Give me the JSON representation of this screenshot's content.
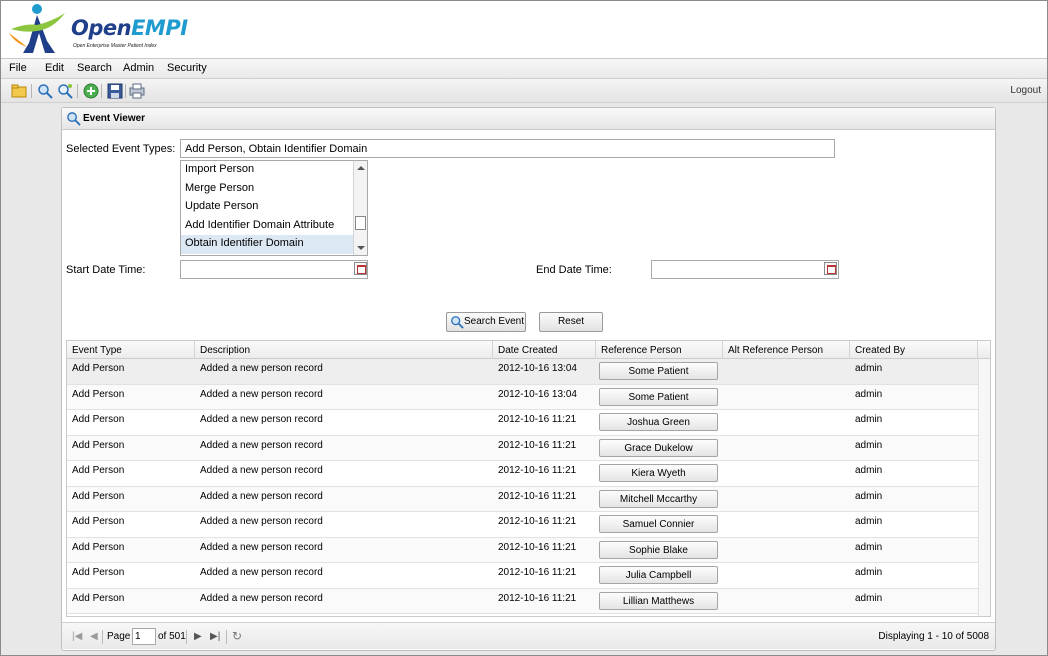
{
  "app": {
    "logo_main_a": "Open",
    "logo_main_b": "EMPI",
    "logo_sub": "Open Enterprise Master Patient Index"
  },
  "menu": {
    "items": [
      "File",
      "Edit",
      "Search",
      "Admin",
      "Security"
    ]
  },
  "toolbar": {
    "icons": [
      "open-folder-icon",
      "zoom-search-icon",
      "advanced-search-icon",
      "add-icon",
      "save-icon",
      "print-icon"
    ],
    "logout_label": "Logout"
  },
  "panel": {
    "title": "Event Viewer",
    "selected_event_types_label": "Selected Event Types:",
    "selected_event_types_value": "Add Person, Obtain Identifier Domain",
    "event_type_options": [
      "Import Person",
      "Merge Person",
      "Update Person",
      "Add Identifier Domain Attribute",
      "Obtain Identifier Domain"
    ],
    "selected_option": "Obtain Identifier Domain",
    "start_date_label": "Start Date Time:",
    "start_date_value": "",
    "end_date_label": "End Date Time:",
    "end_date_value": "",
    "search_button": "Search Event",
    "reset_button": "Reset"
  },
  "grid": {
    "columns": [
      "Event Type",
      "Description",
      "Date Created",
      "Reference Person",
      "Alt Reference Person",
      "Created By"
    ],
    "rows": [
      {
        "event_type": "Add Person",
        "description": "Added a new person record",
        "date_created": "2012-10-16 13:04",
        "reference_person": "Some Patient",
        "alt_reference_person": "",
        "created_by": "admin"
      },
      {
        "event_type": "Add Person",
        "description": "Added a new person record",
        "date_created": "2012-10-16 13:04",
        "reference_person": "Some Patient",
        "alt_reference_person": "",
        "created_by": "admin"
      },
      {
        "event_type": "Add Person",
        "description": "Added a new person record",
        "date_created": "2012-10-16 11:21",
        "reference_person": "Joshua Green",
        "alt_reference_person": "",
        "created_by": "admin"
      },
      {
        "event_type": "Add Person",
        "description": "Added a new person record",
        "date_created": "2012-10-16 11:21",
        "reference_person": "Grace Dukelow",
        "alt_reference_person": "",
        "created_by": "admin"
      },
      {
        "event_type": "Add Person",
        "description": "Added a new person record",
        "date_created": "2012-10-16 11:21",
        "reference_person": "Kiera Wyeth",
        "alt_reference_person": "",
        "created_by": "admin"
      },
      {
        "event_type": "Add Person",
        "description": "Added a new person record",
        "date_created": "2012-10-16 11:21",
        "reference_person": "Mitchell Mccarthy",
        "alt_reference_person": "",
        "created_by": "admin"
      },
      {
        "event_type": "Add Person",
        "description": "Added a new person record",
        "date_created": "2012-10-16 11:21",
        "reference_person": "Samuel Connier",
        "alt_reference_person": "",
        "created_by": "admin"
      },
      {
        "event_type": "Add Person",
        "description": "Added a new person record",
        "date_created": "2012-10-16 11:21",
        "reference_person": "Sophie Blake",
        "alt_reference_person": "",
        "created_by": "admin"
      },
      {
        "event_type": "Add Person",
        "description": "Added a new person record",
        "date_created": "2012-10-16 11:21",
        "reference_person": "Julia Campbell",
        "alt_reference_person": "",
        "created_by": "admin"
      },
      {
        "event_type": "Add Person",
        "description": "Added a new person record",
        "date_created": "2012-10-16 11:21",
        "reference_person": "Lillian Matthews",
        "alt_reference_person": "",
        "created_by": "admin"
      }
    ]
  },
  "pager": {
    "page_label": "Page",
    "page_value": "1",
    "of_label": "of 501",
    "display_text": "Displaying 1 - 10 of 5008"
  }
}
